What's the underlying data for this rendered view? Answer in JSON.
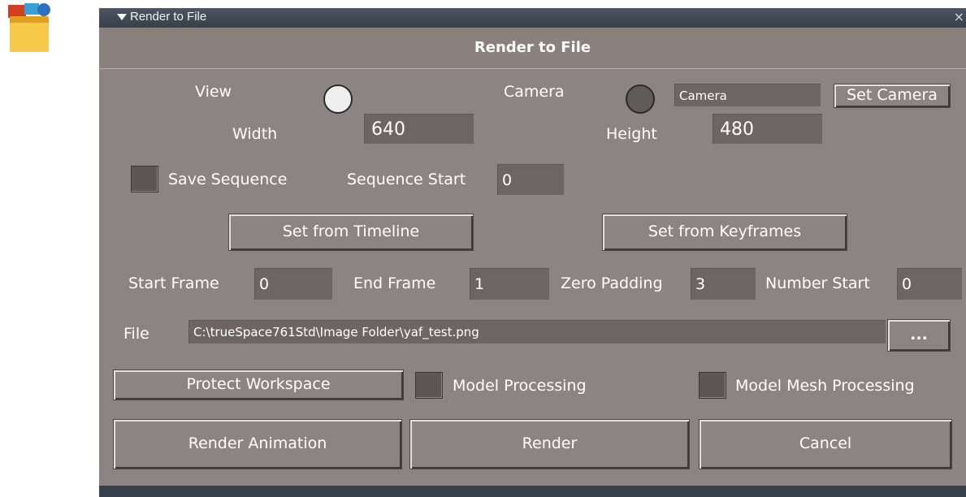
{
  "titlebar": {
    "title": "Render to File",
    "close_glyph": "×"
  },
  "header": {
    "title": "Render to File"
  },
  "view": {
    "view_label": "View",
    "camera_label": "Camera",
    "camera_value": "Camera",
    "set_camera_label": "Set Camera"
  },
  "size": {
    "width_label": "Width",
    "width_value": "640",
    "height_label": "Height",
    "height_value": "480"
  },
  "sequence": {
    "save_sequence_label": "Save Sequence",
    "start_label": "Sequence Start",
    "start_value": "0"
  },
  "timeline": {
    "set_from_timeline_label": "Set from Timeline",
    "set_from_keyframes_label": "Set from Keyframes"
  },
  "frames": {
    "start_label": "Start Frame",
    "start_value": "0",
    "end_label": "End Frame",
    "end_value": "1",
    "zero_padding_label": "Zero Padding",
    "zero_padding_value": "3",
    "number_start_label": "Number Start",
    "number_start_value": "0"
  },
  "file": {
    "label": "File",
    "path": "C:\\trueSpace761Std\\Image Folder\\yaf_test.png",
    "browse_label": "..."
  },
  "options": {
    "protect_workspace_label": "Protect Workspace",
    "model_processing_label": "Model Processing",
    "model_mesh_processing_label": "Model Mesh Processing"
  },
  "actions": {
    "render_animation_label": "Render Animation",
    "render_label": "Render",
    "cancel_label": "Cancel"
  },
  "icons": {
    "app": "app-folder-icon",
    "collapse": "triangle-down-icon",
    "close": "close-icon"
  },
  "colors": {
    "panel": "#8c8482",
    "titlebar": "#36414b",
    "field": "#6c6563",
    "text": "#ffffff"
  }
}
